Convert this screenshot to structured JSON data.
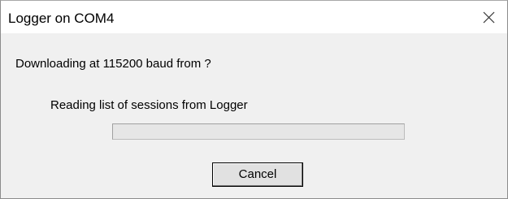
{
  "window": {
    "title": "Logger on COM4",
    "close_icon": "close-x-icon"
  },
  "dialog": {
    "status_text": "Downloading at 115200 baud from ?",
    "sub_status_text": "Reading list of sessions from Logger",
    "progress_fraction": 0,
    "cancel_label": "Cancel"
  },
  "colors": {
    "client_background": "#f0f0f0",
    "titlebar_background": "#ffffff",
    "progress_fill": "#06b025"
  }
}
